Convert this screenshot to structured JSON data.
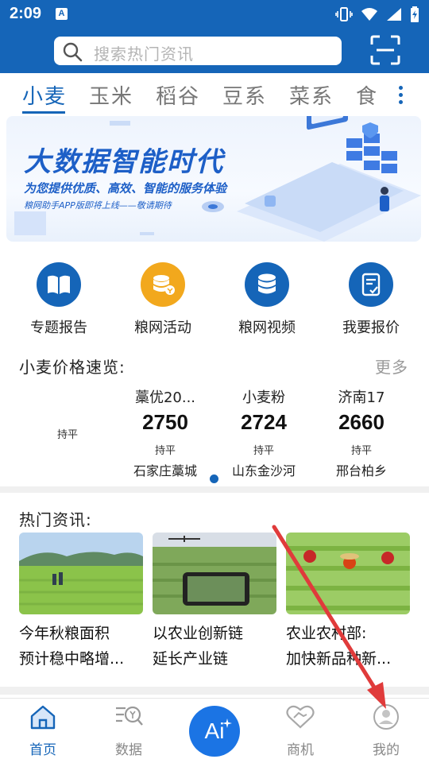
{
  "status": {
    "time": "2:09",
    "app_badge": "A"
  },
  "search": {
    "placeholder": "搜索热门资讯"
  },
  "tabs": [
    {
      "label": "小麦",
      "active": true
    },
    {
      "label": "玉米"
    },
    {
      "label": "稻谷"
    },
    {
      "label": "豆系"
    },
    {
      "label": "菜系"
    },
    {
      "label": "食用"
    }
  ],
  "banner": {
    "title": "大数据智能时代",
    "subtitle": "为您提供优质、高效、智能的服务体验",
    "note": "粮网助手APP版即将上线——敬请期待"
  },
  "quick_actions": [
    {
      "label": "专题报告",
      "icon": "book-icon",
      "color": "#1565b8"
    },
    {
      "label": "粮网活动",
      "icon": "coins-icon",
      "color": "#f2a81d"
    },
    {
      "label": "粮网视频",
      "icon": "database-icon",
      "color": "#1565b8"
    },
    {
      "label": "我要报价",
      "icon": "quote-form-icon",
      "color": "#1565b8"
    }
  ],
  "price_overview": {
    "title": "小麦价格速览:",
    "more": "更多",
    "lone_status": "持平",
    "items": [
      {
        "name": "藁优20...",
        "value": "2750",
        "status": "持平",
        "location": "石家庄藁城"
      },
      {
        "name": "小麦粉",
        "value": "2724",
        "status": "持平",
        "location": "山东金沙河"
      },
      {
        "name": "济南17",
        "value": "2660",
        "status": "持平",
        "location": "邢台柏乡"
      }
    ]
  },
  "news": {
    "title": "热门资讯:",
    "items": [
      {
        "line1": "今年秋粮面积",
        "line2": "预计稳中略增..."
      },
      {
        "line1": "以农业创新链",
        "line2": "延长产业链"
      },
      {
        "line1": "农业农村部:",
        "line2": "加快新品种新..."
      }
    ]
  },
  "bottom_nav": {
    "home": "首页",
    "data": "数据",
    "ai": "Ai",
    "business": "商机",
    "mine": "我的"
  },
  "colors": {
    "brand": "#1565b8",
    "accent": "#f2a81d",
    "annotation_arrow": "#e03b3b"
  }
}
